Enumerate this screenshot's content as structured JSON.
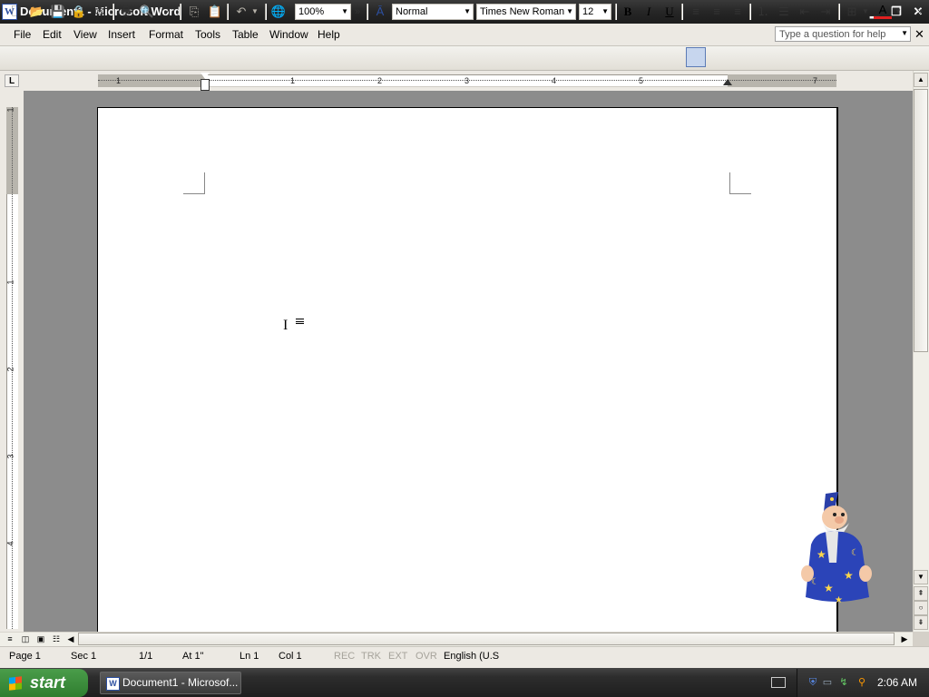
{
  "window": {
    "title": "Document1 - Microsoft Word",
    "app_icon_letter": "W",
    "minimize": "▁",
    "restore": "❐",
    "close": "✕"
  },
  "menu": {
    "items": [
      "File",
      "Edit",
      "View",
      "Insert",
      "Format",
      "Tools",
      "Table",
      "Window",
      "Help"
    ],
    "help_placeholder": "Type a question for help",
    "doc_close": "✕"
  },
  "toolbar": {
    "zoom": "100%",
    "more": "»",
    "style": "Normal",
    "font": "Times New Roman",
    "font_size": "12",
    "bold": "B",
    "italic": "I",
    "underline": "U",
    "font_color_letter": "A"
  },
  "ruler": {
    "tab_selector": "L",
    "h_numbers": [
      "1",
      "1",
      "2",
      "3",
      "4",
      "5",
      "7"
    ],
    "v_numbers": [
      "1",
      "1",
      "2",
      "3",
      "4"
    ]
  },
  "status": {
    "page": "Page 1",
    "sec": "Sec 1",
    "pages": "1/1",
    "at": "At 1\"",
    "ln": "Ln 1",
    "col": "Col 1",
    "rec": "REC",
    "trk": "TRK",
    "ext": "EXT",
    "ovr": "OVR",
    "language": "English (U.S"
  },
  "taskbar": {
    "start": "start",
    "task_item": "Document1 - Microsof...",
    "clock": "2:06 AM"
  },
  "colors": {
    "accent_font_color": "#e02020",
    "start_green": "#3a8f3a",
    "page": "#ffffff",
    "desk": "#8c8c8c"
  }
}
